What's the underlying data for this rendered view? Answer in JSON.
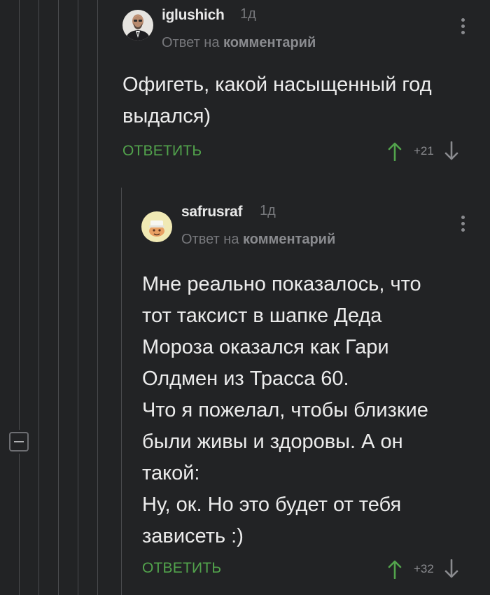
{
  "comments": [
    {
      "username": "iglushich",
      "time": "1д",
      "reply_prefix": "Ответ на",
      "reply_target": "комментарий",
      "text": "Офигеть, какой насыщенный год\nвыдался)",
      "reply_label": "ОТВЕТИТЬ",
      "rating": "+21"
    },
    {
      "username": "safrusraf",
      "time": "1д",
      "reply_prefix": "Ответ на",
      "reply_target": "комментарий",
      "text": "Мне реально показалось, что\nтот таксист в шапке Деда\nМороза оказался как Гари\nОлдмен из Трасса 60.\nЧто я пожелал, чтобы близкие\nбыли живы и здоровы. А он\nтакой:\nНу, ок. Но это будет от тебя\nзависеть :)",
      "reply_label": "ОТВЕТИТЬ",
      "rating": "+32"
    }
  ],
  "colors": {
    "background": "#222325",
    "accent": "#52a34c",
    "thread_line": "#4a4b4e"
  },
  "icons": {
    "upvote": "arrow-up-icon",
    "downvote": "arrow-down-icon",
    "menu": "more-vertical-icon",
    "collapse": "minus-square-icon"
  }
}
